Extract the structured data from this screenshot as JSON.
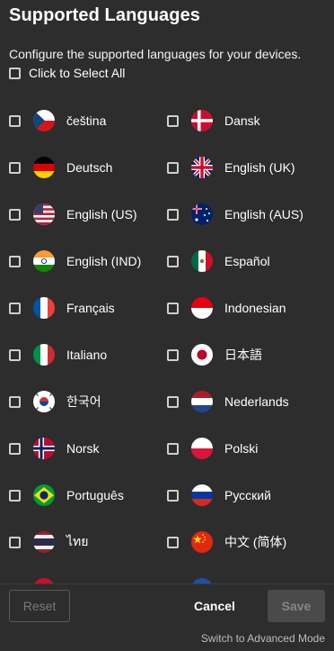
{
  "header": {
    "title": "Supported Languages",
    "subtitle": "Configure the supported languages for your devices."
  },
  "select_all": {
    "label": "Click to Select All",
    "checked": false
  },
  "languages": [
    {
      "label": "čeština",
      "flag": "czech-flag-icon",
      "checked": false
    },
    {
      "label": "Dansk",
      "flag": "denmark-flag-icon",
      "checked": false
    },
    {
      "label": "Deutsch",
      "flag": "germany-flag-icon",
      "checked": false
    },
    {
      "label": "English (UK)",
      "flag": "uk-flag-icon",
      "checked": false
    },
    {
      "label": "English (US)",
      "flag": "us-flag-icon",
      "checked": false
    },
    {
      "label": "English (AUS)",
      "flag": "australia-flag-icon",
      "checked": false
    },
    {
      "label": "English (IND)",
      "flag": "india-flag-icon",
      "checked": false
    },
    {
      "label": "Español",
      "flag": "mexico-flag-icon",
      "checked": false
    },
    {
      "label": "Français",
      "flag": "france-flag-icon",
      "checked": false
    },
    {
      "label": "Indonesian",
      "flag": "indonesia-flag-icon",
      "checked": false
    },
    {
      "label": "Italiano",
      "flag": "italy-flag-icon",
      "checked": false
    },
    {
      "label": "日本語",
      "flag": "japan-flag-icon",
      "checked": false
    },
    {
      "label": "한국어",
      "flag": "korea-flag-icon",
      "checked": false
    },
    {
      "label": "Nederlands",
      "flag": "netherlands-flag-icon",
      "checked": false
    },
    {
      "label": "Norsk",
      "flag": "norway-flag-icon",
      "checked": false
    },
    {
      "label": "Polski",
      "flag": "poland-flag-icon",
      "checked": false
    },
    {
      "label": "Português",
      "flag": "brazil-flag-icon",
      "checked": false
    },
    {
      "label": "Русский",
      "flag": "russia-flag-icon",
      "checked": false
    },
    {
      "label": "ไทย",
      "flag": "thailand-flag-icon",
      "checked": false
    },
    {
      "label": "中文 (简体)",
      "flag": "china-flag-icon",
      "checked": false
    }
  ],
  "footer": {
    "reset_label": "Reset",
    "cancel_label": "Cancel",
    "save_label": "Save",
    "advanced_label": "Switch to Advanced Mode"
  },
  "colors": {
    "background": "#2d2d2d",
    "text": "#ffffff",
    "disabled_text": "#7a7a7a",
    "save_bg": "#4a4a4a"
  }
}
